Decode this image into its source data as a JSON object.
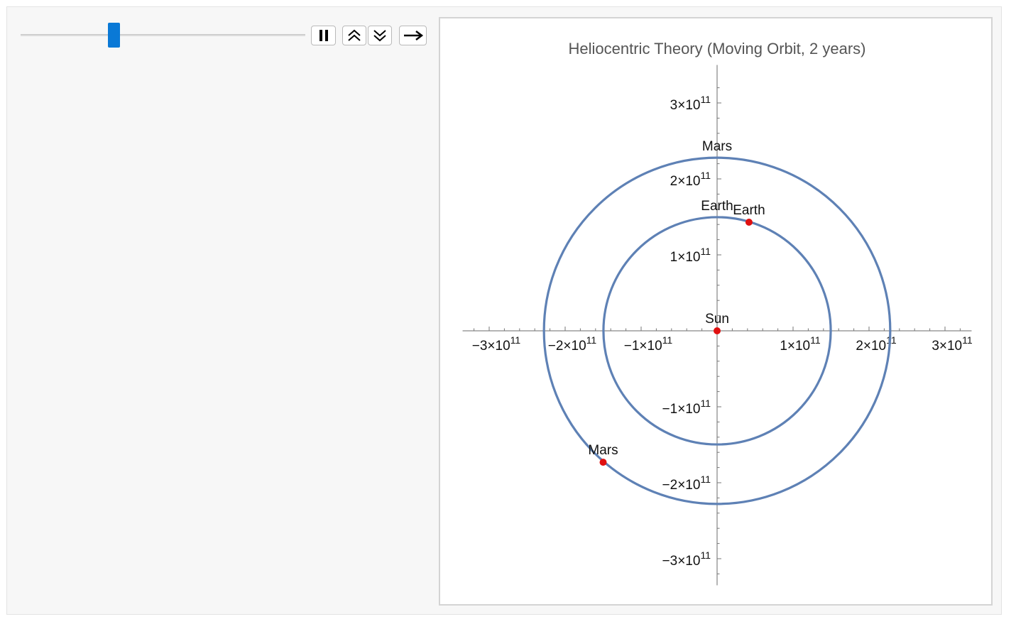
{
  "controls": {
    "slider_fraction": 0.32,
    "pause_icon": "pause-icon",
    "faster_icon": "double-chevron-up-icon",
    "slower_icon": "double-chevron-down-icon",
    "direction_icon": "right-arrow-icon"
  },
  "colors": {
    "orbit": "#5e81b5",
    "planet": "#e01010",
    "slider": "#0a79d6"
  },
  "chart_data": {
    "type": "scatter",
    "title": "Heliocentric Theory (Moving Orbit, 2 years)",
    "xlabel": "",
    "ylabel": "",
    "xlim": [
      -335000000000.0,
      335000000000.0
    ],
    "ylim": [
      -335000000000.0,
      350000000000.0
    ],
    "x_ticks": [
      {
        "value": -300000000000.0,
        "mantissa": "−3",
        "base": "×10",
        "exp": "11"
      },
      {
        "value": -200000000000.0,
        "mantissa": "−2",
        "base": "×10",
        "exp": "11"
      },
      {
        "value": -100000000000.0,
        "mantissa": "−1",
        "base": "×10",
        "exp": "11"
      },
      {
        "value": 100000000000.0,
        "mantissa": "1",
        "base": "×10",
        "exp": "11"
      },
      {
        "value": 200000000000.0,
        "mantissa": "2",
        "base": "×10",
        "exp": "11"
      },
      {
        "value": 300000000000.0,
        "mantissa": "3",
        "base": "×10",
        "exp": "11"
      }
    ],
    "y_ticks": [
      {
        "value": 300000000000.0,
        "mantissa": "3",
        "base": "×10",
        "exp": "11"
      },
      {
        "value": 200000000000.0,
        "mantissa": "2",
        "base": "×10",
        "exp": "11"
      },
      {
        "value": 100000000000.0,
        "mantissa": "1",
        "base": "×10",
        "exp": "11"
      },
      {
        "value": -100000000000.0,
        "mantissa": "−1",
        "base": "×10",
        "exp": "11"
      },
      {
        "value": -200000000000.0,
        "mantissa": "−2",
        "base": "×10",
        "exp": "11"
      },
      {
        "value": -300000000000.0,
        "mantissa": "−3",
        "base": "×10",
        "exp": "11"
      }
    ],
    "orbits": [
      {
        "name": "Earth",
        "radius": 149600000000.0,
        "label_angle_deg": 90
      },
      {
        "name": "Mars",
        "radius": 227900000000.0,
        "label_angle_deg": 90
      }
    ],
    "points": [
      {
        "name": "Sun",
        "x": 0,
        "y": 0
      },
      {
        "name": "Earth",
        "x": 42000000000.0,
        "y": 143000000000.0
      },
      {
        "name": "Mars",
        "x": -150000000000.0,
        "y": -173000000000.0
      }
    ],
    "grid": false
  }
}
